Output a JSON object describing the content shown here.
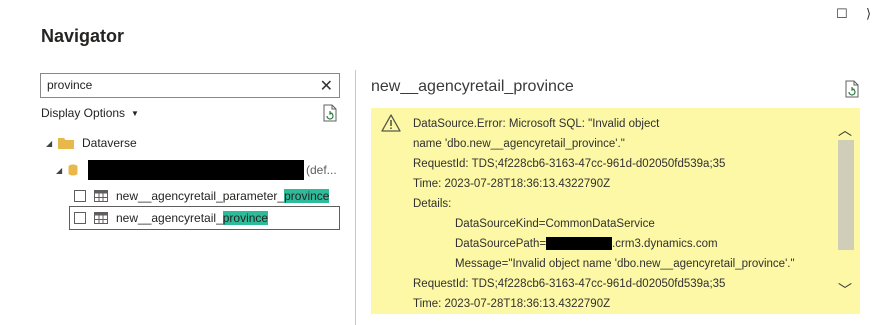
{
  "window": {
    "maximize_icon": "☐",
    "close_icon": "⟩"
  },
  "title": "Navigator",
  "search": {
    "value": "province",
    "clear_icon": "✕"
  },
  "display_options": {
    "label": "Display Options",
    "caret": "▼"
  },
  "tree": {
    "root": {
      "label": "Dataverse",
      "expander": "◢"
    },
    "environment": {
      "suffix": "(def...",
      "expander": "◢"
    },
    "items": [
      {
        "prefix": "new__agencyretail_parameter_",
        "highlight": "province"
      },
      {
        "prefix": "new__agencyretail_",
        "highlight": "province"
      }
    ]
  },
  "preview": {
    "title": "new__agencyretail_province",
    "error_lines": [
      "DataSource.Error: Microsoft SQL: \"Invalid object",
      "name 'dbo.new__agencyretail_province'.\"",
      "RequestId: TDS;4f228cb6-3163-47cc-961d-d02050fd539a;35",
      "Time: 2023-07-28T18:36:13.4322790Z",
      "Details:",
      "DataSourceKind=CommonDataService",
      ".crm3.dynamics.com",
      "Message=\"Invalid object name 'dbo.new__agencyretail_province'.\"",
      "RequestId: TDS;4f228cb6-3163-47cc-961d-d02050fd539a;35",
      "Time: 2023-07-28T18:36:13.4322790Z"
    ],
    "datasource_path_label": "DataSourcePath=",
    "scroll_up": "︿",
    "scroll_down": "﹀"
  },
  "colors": {
    "highlight": "#2dbb99",
    "error_background": "#fcf8a6",
    "folder": "#e8b84a"
  }
}
